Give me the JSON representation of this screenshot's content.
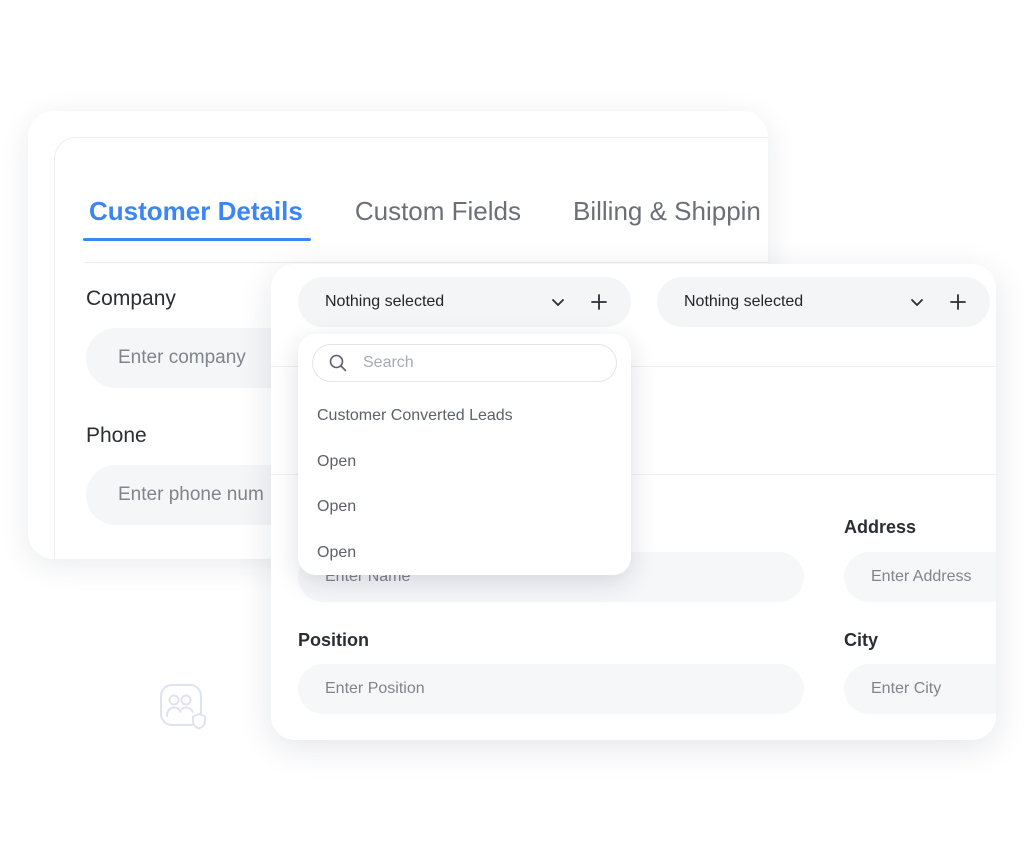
{
  "back_card": {
    "tabs": [
      {
        "label": "Customer Details",
        "active": true
      },
      {
        "label": "Custom Fields",
        "active": false
      },
      {
        "label": "Billing & Shippin",
        "active": false
      }
    ],
    "company_label": "Company",
    "company_placeholder": "Enter company",
    "phone_label": "Phone",
    "phone_placeholder": "Enter phone num"
  },
  "front_card": {
    "select_1": {
      "value": "Nothing selected"
    },
    "select_2": {
      "value": "Nothing selected"
    },
    "name_placeholder": "Enter Name",
    "address_label": "Address",
    "address_placeholder": "Enter Address",
    "position_label": "Position",
    "position_placeholder": "Enter Position",
    "city_label": "City",
    "city_placeholder": "Enter City"
  },
  "dropdown": {
    "search_placeholder": "Search",
    "items": [
      "Customer Converted Leads",
      "Open",
      "Open",
      "Open"
    ]
  },
  "colors": {
    "accent": "#3b86f0",
    "text": "#2a2d33",
    "muted": "#6b6f78",
    "input_bg": "#f5f6f8"
  },
  "icons": [
    "chevron-down-icon",
    "plus-icon",
    "search-icon",
    "users-shield-icon"
  ]
}
